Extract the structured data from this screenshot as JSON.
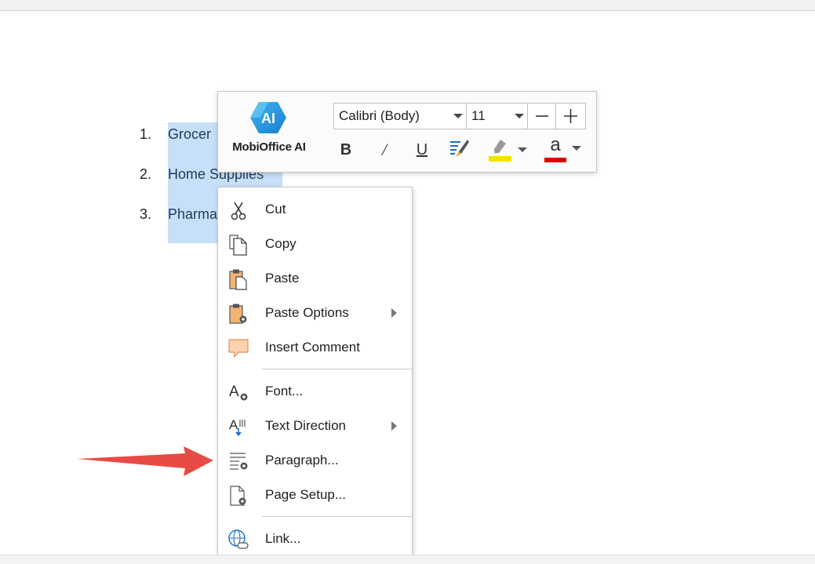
{
  "document": {
    "list": [
      {
        "number": "1.",
        "text": "Grocer"
      },
      {
        "number": "2.",
        "text": "Home Supplies"
      },
      {
        "number": "3.",
        "text": "Pharma"
      }
    ]
  },
  "mini_toolbar": {
    "ai_icon_text": "AI",
    "ai_label": "MobiOffice AI",
    "font_name": "Calibri (Body)",
    "font_size": "11",
    "buttons": {
      "bold": "B",
      "italic": "/",
      "underline": "U",
      "font_color_glyph": "a"
    },
    "colors": {
      "highlight": "#f2e400",
      "font_color": "#e00000"
    }
  },
  "context_menu": {
    "items": [
      {
        "label": "Cut",
        "icon": "scissors-icon"
      },
      {
        "label": "Copy",
        "icon": "copy-icon"
      },
      {
        "label": "Paste",
        "icon": "clipboard-icon"
      },
      {
        "label": "Paste Options",
        "icon": "paste-options-icon",
        "submenu": true
      },
      {
        "label": "Insert Comment",
        "icon": "comment-icon"
      },
      {
        "label": "Font...",
        "icon": "font-settings-icon"
      },
      {
        "label": "Text Direction",
        "icon": "text-direction-icon",
        "submenu": true
      },
      {
        "label": "Paragraph...",
        "icon": "paragraph-settings-icon"
      },
      {
        "label": "Page Setup...",
        "icon": "page-setup-icon"
      },
      {
        "label": "Link...",
        "icon": "link-icon"
      }
    ]
  },
  "annotation": {
    "arrow_color": "#e84a45"
  }
}
